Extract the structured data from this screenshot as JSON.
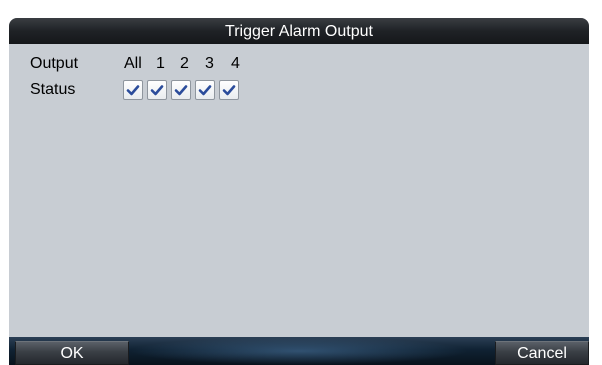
{
  "dialog": {
    "title": "Trigger Alarm Output",
    "output_label": "Output",
    "status_label": "Status",
    "outputs": [
      {
        "label": "All",
        "checked": true
      },
      {
        "label": "1",
        "checked": true
      },
      {
        "label": "2",
        "checked": true
      },
      {
        "label": "3",
        "checked": true
      },
      {
        "label": "4",
        "checked": true
      }
    ],
    "check_color": "#2b4c9b"
  },
  "footer": {
    "ok_label": "OK",
    "cancel_label": "Cancel"
  }
}
